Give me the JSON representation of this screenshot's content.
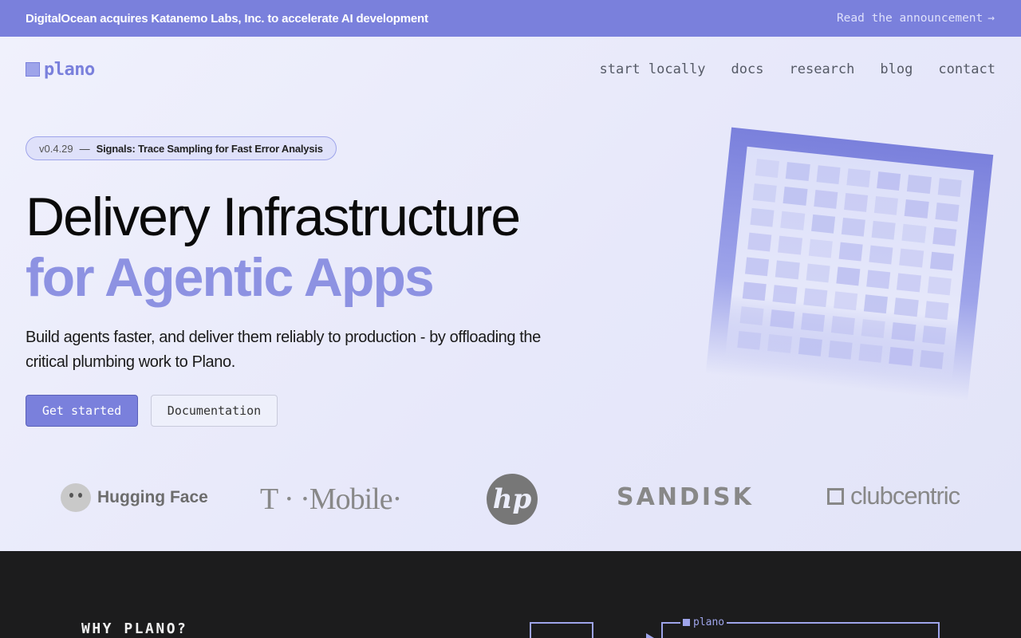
{
  "announcement": {
    "text": "DigitalOcean acquires Katanemo Labs, Inc. to accelerate AI development",
    "link_label": "Read the announcement",
    "link_arrow": "→"
  },
  "nav": {
    "logo_text": "plano",
    "links": [
      "start locally",
      "docs",
      "research",
      "blog",
      "contact"
    ]
  },
  "release_pill": {
    "version": "v0.4.29",
    "separator": "—",
    "title": "Signals: Trace Sampling for Fast Error Analysis"
  },
  "hero": {
    "headline_line1": "Delivery Infrastructure",
    "headline_line2": "for Agentic Apps",
    "subtext": "Build agents faster, and deliver them reliably to production - by offloading the critical plumbing work to Plano.",
    "primary_button": "Get started",
    "secondary_button": "Documentation"
  },
  "logos": {
    "hugging_face": "Hugging Face",
    "t_mobile": "T · ·Mobile·",
    "hp": "hp",
    "sandisk": "SANDISK",
    "clubcentric": "clubcentric"
  },
  "why_section": {
    "heading": "WHY PLANO?",
    "diagram_label": "plano"
  },
  "colors": {
    "accent": "#7a80dc",
    "accent_light": "#8d92e2",
    "dark_bg": "#1c1c1d"
  }
}
